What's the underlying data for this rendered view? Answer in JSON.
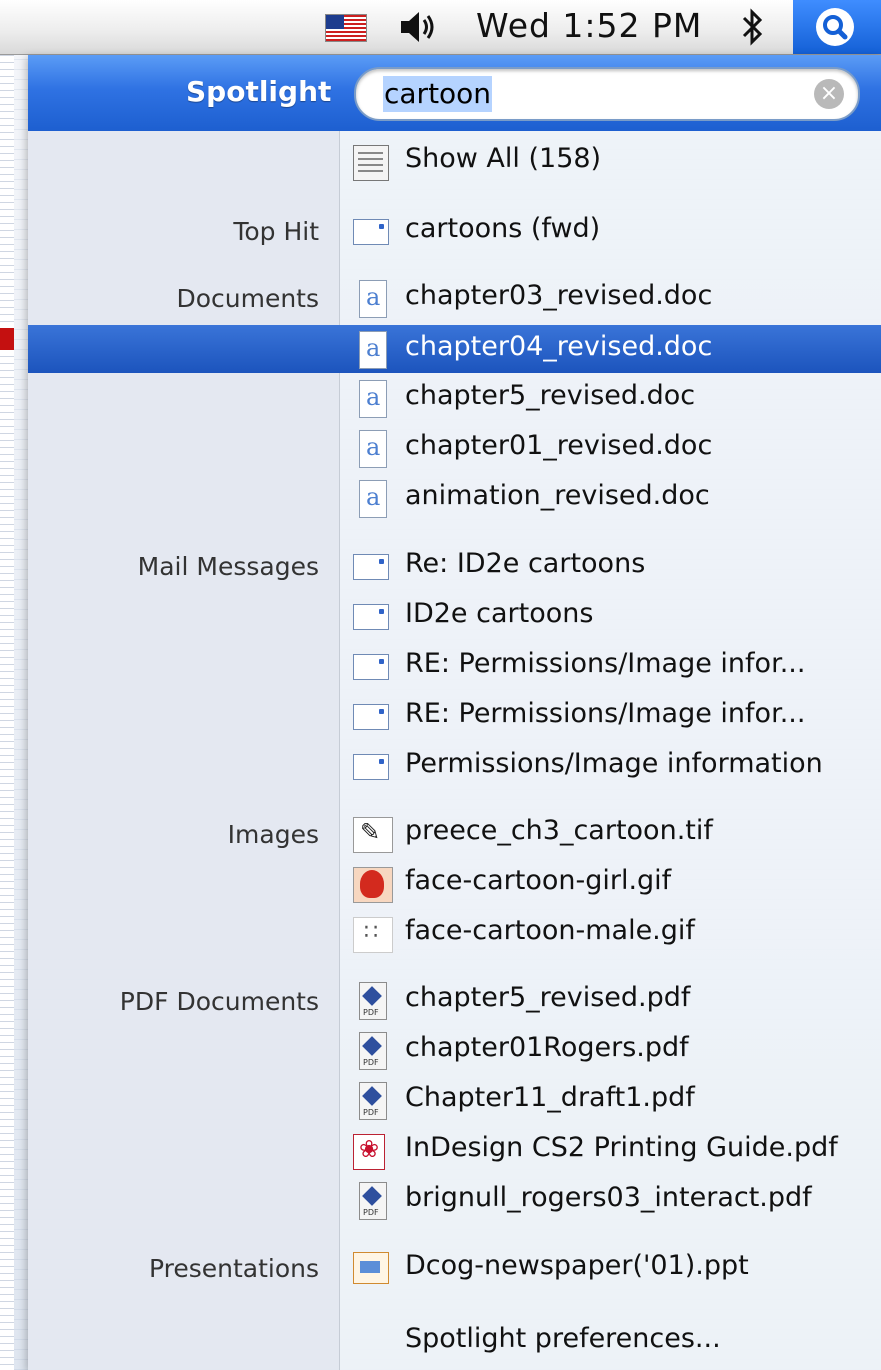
{
  "menubar": {
    "clock": "Wed 1:52 PM",
    "icons": [
      "us-flag-icon",
      "volume-icon",
      "bluetooth-icon",
      "spotlight-icon"
    ]
  },
  "spotlight": {
    "label": "Spotlight",
    "query": "cartoon",
    "show_all": "Show All (158)",
    "preferences": "Spotlight preferences...",
    "categories": {
      "top_hit": "Top Hit",
      "documents": "Documents",
      "mail": "Mail Messages",
      "images": "Images",
      "pdf": "PDF Documents",
      "presentations": "Presentations"
    },
    "results": {
      "top_hit": [
        "cartoons (fwd)"
      ],
      "documents": [
        "chapter03_revised.doc",
        "chapter04_revised.doc",
        "chapter5_revised.doc",
        "chapter01_revised.doc",
        "animation_revised.doc"
      ],
      "mail": [
        "Re: ID2e cartoons",
        "ID2e cartoons",
        "RE: Permissions/Image infor...",
        "RE: Permissions/Image infor...",
        "Permissions/Image information"
      ],
      "images": [
        "preece_ch3_cartoon.tif",
        "face-cartoon-girl.gif",
        "face-cartoon-male.gif"
      ],
      "pdf": [
        "chapter5_revised.pdf",
        "chapter01Rogers.pdf",
        "Chapter11_draft1.pdf",
        "InDesign CS2 Printing Guide.pdf",
        "brignull_rogers03_interact.pdf"
      ],
      "presentations": [
        "Dcog-newspaper('01).ppt"
      ]
    },
    "selected": "chapter04_revised.doc"
  },
  "colors": {
    "accent": "#1d5fd0",
    "selection": "#2a62c9"
  }
}
